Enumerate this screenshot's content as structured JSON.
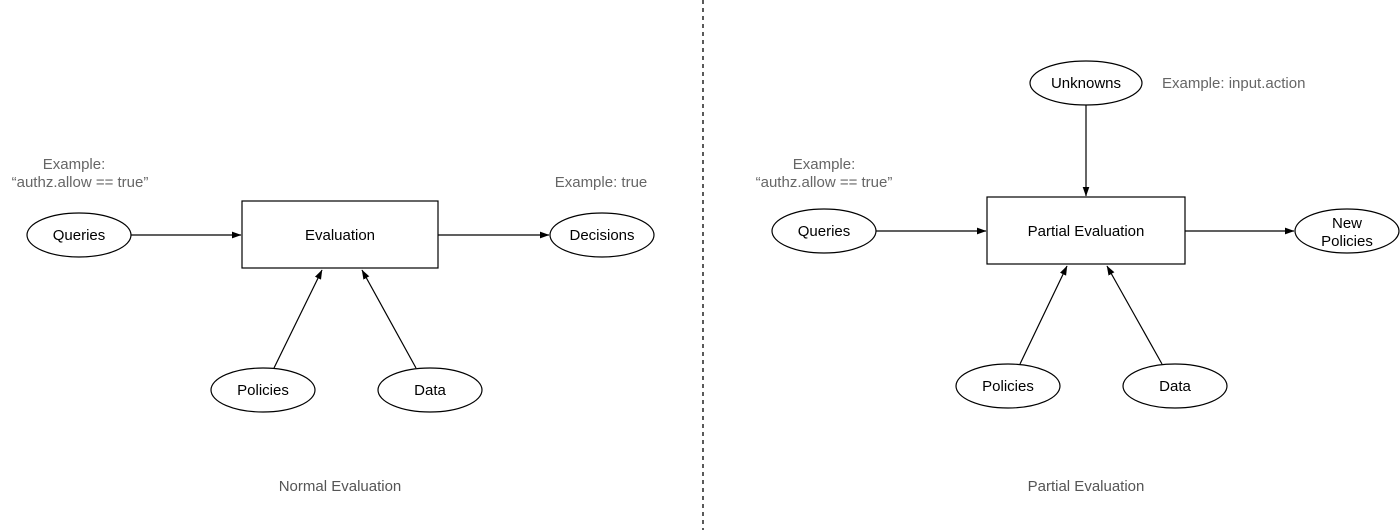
{
  "panels": [
    {
      "id": "normal",
      "caption": "Normal Evaluation",
      "process": "Evaluation",
      "nodes": {
        "queries": "Queries",
        "output": [
          "Decisions"
        ],
        "policies": "Policies",
        "data": "Data"
      },
      "notes": {
        "queries_example_line1": "Example:",
        "queries_example_line2": "“authz.allow == true”",
        "output_example": "Example: true"
      }
    },
    {
      "id": "partial",
      "caption": "Partial Evaluation",
      "process": "Partial Evaluation",
      "nodes": {
        "unknowns": "Unknowns",
        "queries": "Queries",
        "output": [
          "New",
          "Policies"
        ],
        "policies": "Policies",
        "data": "Data"
      },
      "notes": {
        "queries_example_line1": "Example:",
        "queries_example_line2": "“authz.allow == true”",
        "unknowns_example": "Example: input.action"
      }
    }
  ],
  "edges": [
    {
      "panel": "normal",
      "from": "Queries",
      "to": "Evaluation"
    },
    {
      "panel": "normal",
      "from": "Evaluation",
      "to": "Decisions"
    },
    {
      "panel": "normal",
      "from": "Policies",
      "to": "Evaluation"
    },
    {
      "panel": "normal",
      "from": "Data",
      "to": "Evaluation"
    },
    {
      "panel": "partial",
      "from": "Unknowns",
      "to": "Partial Evaluation"
    },
    {
      "panel": "partial",
      "from": "Queries",
      "to": "Partial Evaluation"
    },
    {
      "panel": "partial",
      "from": "Partial Evaluation",
      "to": "New Policies"
    },
    {
      "panel": "partial",
      "from": "Policies",
      "to": "Partial Evaluation"
    },
    {
      "panel": "partial",
      "from": "Data",
      "to": "Partial Evaluation"
    }
  ]
}
